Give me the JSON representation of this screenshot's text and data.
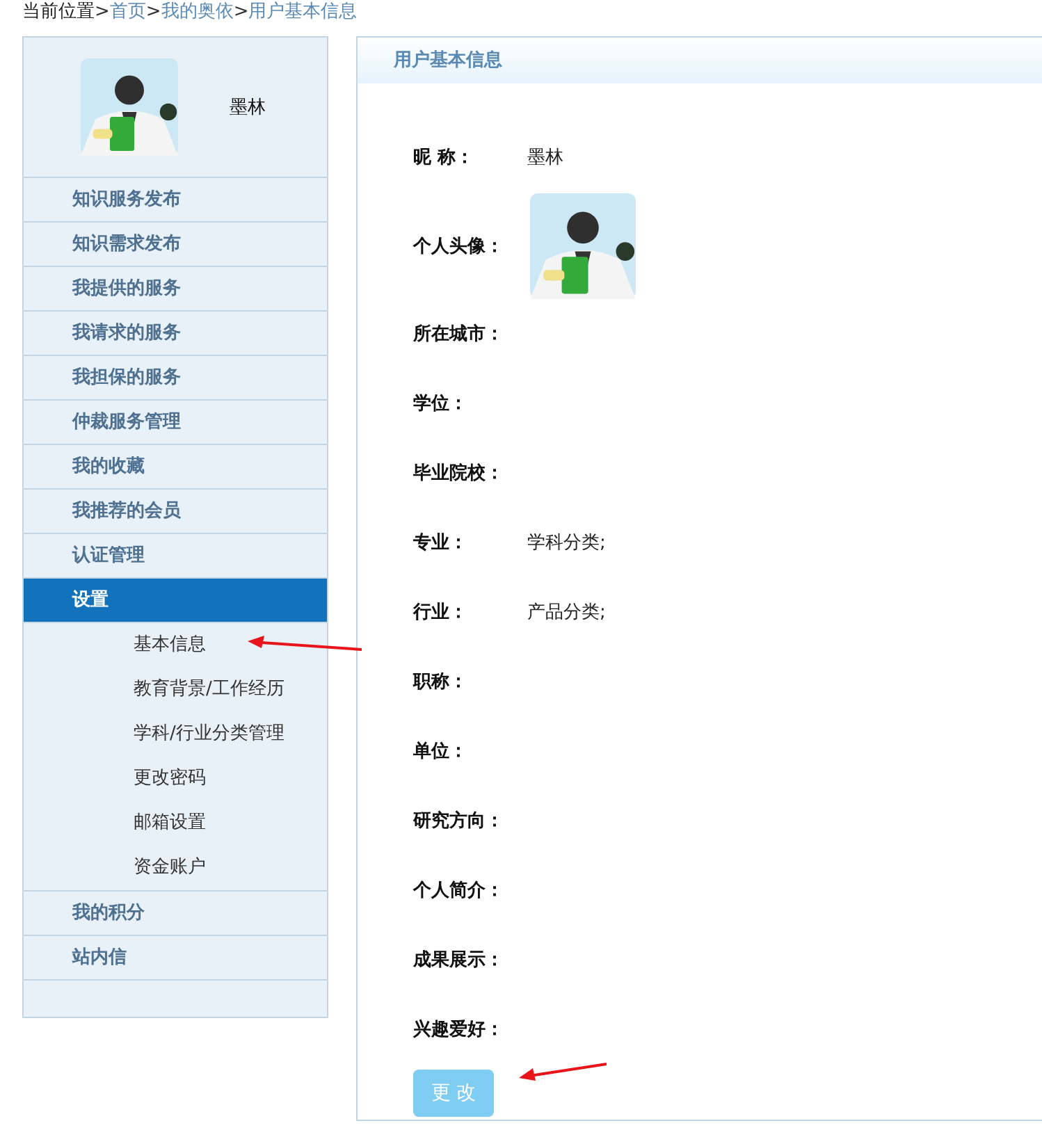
{
  "breadcrumb": {
    "label": "当前位置",
    "separator": ">",
    "items": [
      "首页",
      "我的奥依",
      "用户基本信息"
    ]
  },
  "sidebar": {
    "user_name": "墨林",
    "items": [
      {
        "label": "知识服务发布",
        "selected": false
      },
      {
        "label": "知识需求发布",
        "selected": false
      },
      {
        "label": "我提供的服务",
        "selected": false
      },
      {
        "label": "我请求的服务",
        "selected": false
      },
      {
        "label": "我担保的服务",
        "selected": false
      },
      {
        "label": "仲裁服务管理",
        "selected": false
      },
      {
        "label": "我的收藏",
        "selected": false
      },
      {
        "label": "我推荐的会员",
        "selected": false
      },
      {
        "label": "认证管理",
        "selected": false
      },
      {
        "label": "设置",
        "selected": true,
        "expanded": true,
        "children": [
          {
            "label": "基本信息",
            "selected": false
          },
          {
            "label": "教育背景/工作经历",
            "selected": false
          },
          {
            "label": "学科/行业分类管理",
            "selected": false
          },
          {
            "label": "更改密码",
            "selected": false
          },
          {
            "label": "邮箱设置",
            "selected": false
          },
          {
            "label": "资金账户",
            "selected": false
          }
        ]
      },
      {
        "label": "我的积分",
        "selected": false
      },
      {
        "label": "站内信",
        "selected": false
      }
    ]
  },
  "panel": {
    "title": "用户基本信息",
    "fields": [
      {
        "label": "昵 称：",
        "kind": "text",
        "value": "墨林"
      },
      {
        "label": "个人头像：",
        "kind": "avatar"
      },
      {
        "label": "所在城市：",
        "kind": "text"
      },
      {
        "label": "学位：",
        "kind": "text"
      },
      {
        "label": "毕业院校：",
        "kind": "text"
      },
      {
        "label": "专业：",
        "kind": "text",
        "value": "学科分类;"
      },
      {
        "label": "行业：",
        "kind": "text",
        "value": "产品分类;"
      },
      {
        "label": "职称：",
        "kind": "text"
      },
      {
        "label": "单位：",
        "kind": "text"
      },
      {
        "label": "研究方向：",
        "kind": "text"
      },
      {
        "label": "个人简介：",
        "kind": "text"
      },
      {
        "label": "成果展示：",
        "kind": "text"
      },
      {
        "label": "兴趣爱好：",
        "kind": "text"
      }
    ],
    "button": "更 改"
  }
}
